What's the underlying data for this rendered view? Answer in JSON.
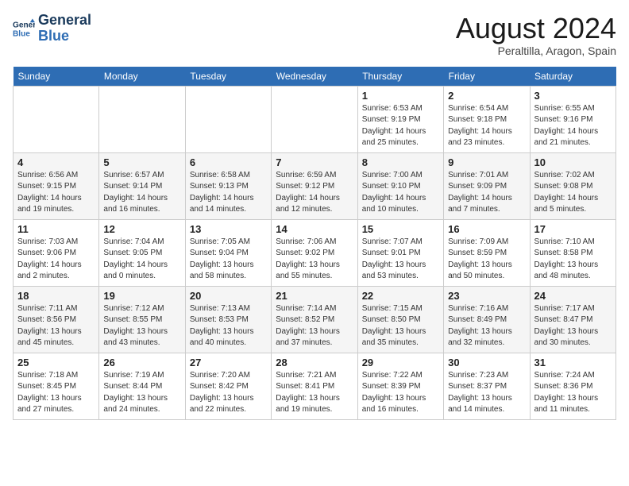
{
  "header": {
    "logo_line1": "General",
    "logo_line2": "Blue",
    "month_year": "August 2024",
    "location": "Peraltilla, Aragon, Spain"
  },
  "days_of_week": [
    "Sunday",
    "Monday",
    "Tuesday",
    "Wednesday",
    "Thursday",
    "Friday",
    "Saturday"
  ],
  "weeks": [
    [
      {
        "day": "",
        "info": ""
      },
      {
        "day": "",
        "info": ""
      },
      {
        "day": "",
        "info": ""
      },
      {
        "day": "",
        "info": ""
      },
      {
        "day": "1",
        "info": "Sunrise: 6:53 AM\nSunset: 9:19 PM\nDaylight: 14 hours\nand 25 minutes."
      },
      {
        "day": "2",
        "info": "Sunrise: 6:54 AM\nSunset: 9:18 PM\nDaylight: 14 hours\nand 23 minutes."
      },
      {
        "day": "3",
        "info": "Sunrise: 6:55 AM\nSunset: 9:16 PM\nDaylight: 14 hours\nand 21 minutes."
      }
    ],
    [
      {
        "day": "4",
        "info": "Sunrise: 6:56 AM\nSunset: 9:15 PM\nDaylight: 14 hours\nand 19 minutes."
      },
      {
        "day": "5",
        "info": "Sunrise: 6:57 AM\nSunset: 9:14 PM\nDaylight: 14 hours\nand 16 minutes."
      },
      {
        "day": "6",
        "info": "Sunrise: 6:58 AM\nSunset: 9:13 PM\nDaylight: 14 hours\nand 14 minutes."
      },
      {
        "day": "7",
        "info": "Sunrise: 6:59 AM\nSunset: 9:12 PM\nDaylight: 14 hours\nand 12 minutes."
      },
      {
        "day": "8",
        "info": "Sunrise: 7:00 AM\nSunset: 9:10 PM\nDaylight: 14 hours\nand 10 minutes."
      },
      {
        "day": "9",
        "info": "Sunrise: 7:01 AM\nSunset: 9:09 PM\nDaylight: 14 hours\nand 7 minutes."
      },
      {
        "day": "10",
        "info": "Sunrise: 7:02 AM\nSunset: 9:08 PM\nDaylight: 14 hours\nand 5 minutes."
      }
    ],
    [
      {
        "day": "11",
        "info": "Sunrise: 7:03 AM\nSunset: 9:06 PM\nDaylight: 14 hours\nand 2 minutes."
      },
      {
        "day": "12",
        "info": "Sunrise: 7:04 AM\nSunset: 9:05 PM\nDaylight: 14 hours\nand 0 minutes."
      },
      {
        "day": "13",
        "info": "Sunrise: 7:05 AM\nSunset: 9:04 PM\nDaylight: 13 hours\nand 58 minutes."
      },
      {
        "day": "14",
        "info": "Sunrise: 7:06 AM\nSunset: 9:02 PM\nDaylight: 13 hours\nand 55 minutes."
      },
      {
        "day": "15",
        "info": "Sunrise: 7:07 AM\nSunset: 9:01 PM\nDaylight: 13 hours\nand 53 minutes."
      },
      {
        "day": "16",
        "info": "Sunrise: 7:09 AM\nSunset: 8:59 PM\nDaylight: 13 hours\nand 50 minutes."
      },
      {
        "day": "17",
        "info": "Sunrise: 7:10 AM\nSunset: 8:58 PM\nDaylight: 13 hours\nand 48 minutes."
      }
    ],
    [
      {
        "day": "18",
        "info": "Sunrise: 7:11 AM\nSunset: 8:56 PM\nDaylight: 13 hours\nand 45 minutes."
      },
      {
        "day": "19",
        "info": "Sunrise: 7:12 AM\nSunset: 8:55 PM\nDaylight: 13 hours\nand 43 minutes."
      },
      {
        "day": "20",
        "info": "Sunrise: 7:13 AM\nSunset: 8:53 PM\nDaylight: 13 hours\nand 40 minutes."
      },
      {
        "day": "21",
        "info": "Sunrise: 7:14 AM\nSunset: 8:52 PM\nDaylight: 13 hours\nand 37 minutes."
      },
      {
        "day": "22",
        "info": "Sunrise: 7:15 AM\nSunset: 8:50 PM\nDaylight: 13 hours\nand 35 minutes."
      },
      {
        "day": "23",
        "info": "Sunrise: 7:16 AM\nSunset: 8:49 PM\nDaylight: 13 hours\nand 32 minutes."
      },
      {
        "day": "24",
        "info": "Sunrise: 7:17 AM\nSunset: 8:47 PM\nDaylight: 13 hours\nand 30 minutes."
      }
    ],
    [
      {
        "day": "25",
        "info": "Sunrise: 7:18 AM\nSunset: 8:45 PM\nDaylight: 13 hours\nand 27 minutes."
      },
      {
        "day": "26",
        "info": "Sunrise: 7:19 AM\nSunset: 8:44 PM\nDaylight: 13 hours\nand 24 minutes."
      },
      {
        "day": "27",
        "info": "Sunrise: 7:20 AM\nSunset: 8:42 PM\nDaylight: 13 hours\nand 22 minutes."
      },
      {
        "day": "28",
        "info": "Sunrise: 7:21 AM\nSunset: 8:41 PM\nDaylight: 13 hours\nand 19 minutes."
      },
      {
        "day": "29",
        "info": "Sunrise: 7:22 AM\nSunset: 8:39 PM\nDaylight: 13 hours\nand 16 minutes."
      },
      {
        "day": "30",
        "info": "Sunrise: 7:23 AM\nSunset: 8:37 PM\nDaylight: 13 hours\nand 14 minutes."
      },
      {
        "day": "31",
        "info": "Sunrise: 7:24 AM\nSunset: 8:36 PM\nDaylight: 13 hours\nand 11 minutes."
      }
    ]
  ]
}
